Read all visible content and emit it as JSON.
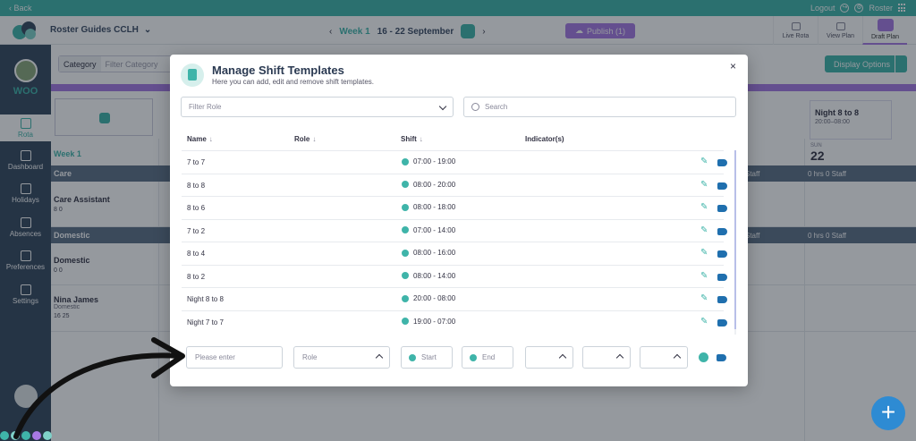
{
  "topbar": {
    "back": "‹ Back",
    "logout": "Logout",
    "roster": "Roster"
  },
  "header": {
    "org_name": "Roster Guides CCLH",
    "week_label": "Week 1",
    "week_dates": "16 - 22 September",
    "publish": "Publish (1)",
    "view_tabs": [
      "Live Rota",
      "View Plan",
      "Draft Plan"
    ]
  },
  "sidebar": {
    "org_short": "WOO",
    "items": [
      "Rota",
      "Dashboard",
      "Holidays",
      "Absences",
      "Preferences",
      "Settings"
    ]
  },
  "content": {
    "filter_label": "Category",
    "filter_placeholder": "Filter Category",
    "display_options": "Display Options",
    "night_card_title": "Night 8 to 8",
    "night_card_time": "20:00–08:00",
    "week_label": "Week 1",
    "day_name": "SUN",
    "day_number": "22",
    "bands": [
      {
        "name": "Care",
        "mid": "Staff",
        "summary": "0 hrs  0 Staff"
      },
      {
        "name": "Domestic",
        "mid": "Staff",
        "summary": "0 hrs  0 Staff"
      }
    ],
    "rows": [
      {
        "name": "Care Assistant",
        "role": "",
        "meta": "8   0"
      },
      {
        "name": "Domestic",
        "role": "",
        "meta": "0   0"
      },
      {
        "name": "Nina James",
        "role": "Domestic",
        "meta": "16   25"
      }
    ]
  },
  "modal": {
    "title": "Manage Shift Templates",
    "subtitle": "Here you can add, edit and remove shift templates.",
    "close": "×",
    "filter_role_placeholder": "Filter Role",
    "search_placeholder": "Search",
    "columns": {
      "name": "Name",
      "role": "Role",
      "shift": "Shift",
      "indicators": "Indicator(s)"
    },
    "sort_arrow": "↓",
    "templates": [
      {
        "name": "7 to 7",
        "shift": "07:00 - 19:00"
      },
      {
        "name": "8 to 8",
        "shift": "08:00 - 20:00"
      },
      {
        "name": "8 to 6",
        "shift": "08:00 - 18:00"
      },
      {
        "name": "7 to 2",
        "shift": "07:00 - 14:00"
      },
      {
        "name": "8 to 4",
        "shift": "08:00 - 16:00"
      },
      {
        "name": "8 to 2",
        "shift": "08:00 - 14:00"
      },
      {
        "name": "Night 8 to 8",
        "shift": "20:00 - 08:00"
      },
      {
        "name": "Night 7 to 7",
        "shift": "19:00 - 07:00"
      }
    ],
    "new_row": {
      "name_placeholder": "Please enter",
      "role_placeholder": "Role",
      "start_placeholder": "Start",
      "end_placeholder": "End"
    }
  },
  "colors": {
    "teal": "#3fb4a9",
    "navy": "#33475e",
    "purple": "#a778e3",
    "blue": "#2e8bd3"
  }
}
